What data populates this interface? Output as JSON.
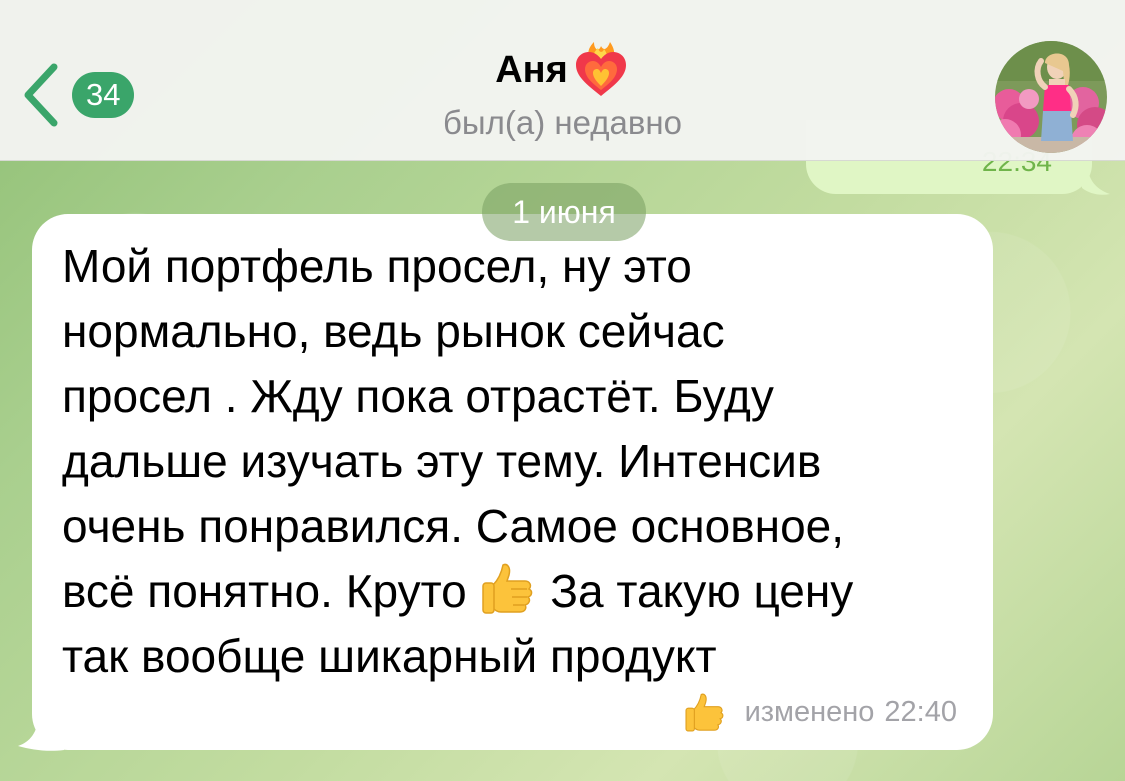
{
  "header": {
    "back_count": "34",
    "title": "Аня",
    "status": "был(а) недавно"
  },
  "previous_message": {
    "partial_text": "22:34"
  },
  "date_separator": "1 июня",
  "message": {
    "lines": [
      "Мой портфель просел, ну это",
      "нормально, ведь рынок сейчас",
      "просел . Жду пока отрастёт. Буду",
      "дальше изучать эту тему. Интенсив",
      "очень понравился. Самое основное,"
    ],
    "line6_before_emoji": "всё понятно. Круто",
    "line6_after_emoji": "За такую цену",
    "line7": "так вообще шикарный продукт",
    "edited_label": "изменено",
    "time": "22:40"
  },
  "icons": {
    "back": "chevron-left-icon",
    "title_emoji": "burning-heart-icon",
    "reaction": "thumbs-up-icon"
  },
  "colors": {
    "accent": "#3aa56a",
    "incoming_bubble": "#ffffff",
    "outgoing_bubble": "#e0f6c5"
  }
}
